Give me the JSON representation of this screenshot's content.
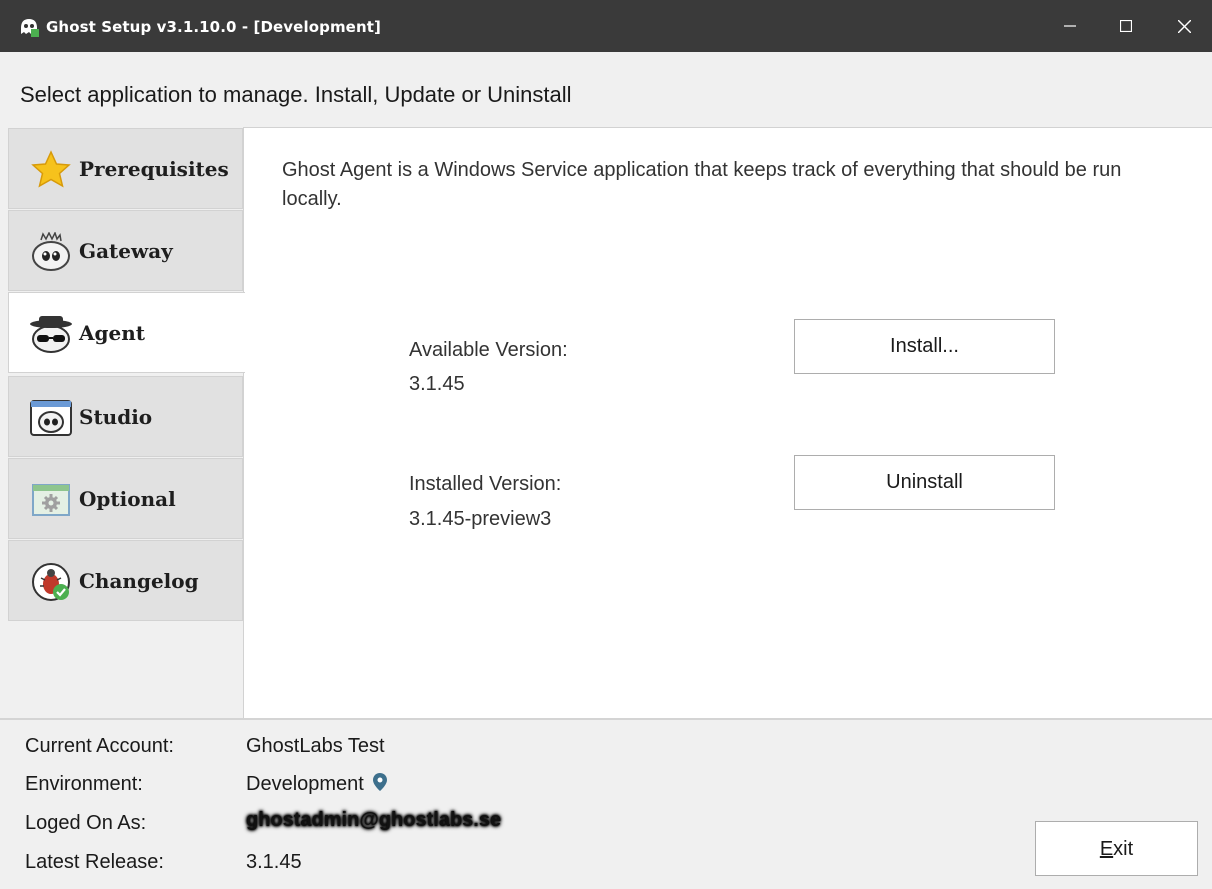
{
  "window": {
    "title": "Ghost Setup v3.1.10.0  -  [Development]",
    "min_icon": "minimize-icon",
    "max_icon": "maximize-icon",
    "close_icon": "close-icon"
  },
  "header": {
    "text": "Select application to manage. Install, Update or Uninstall"
  },
  "tabs": [
    {
      "label": "Prerequisites",
      "icon": "star-icon",
      "active": false
    },
    {
      "label": "Gateway",
      "icon": "ghost-gateway-icon",
      "active": false
    },
    {
      "label": "Agent",
      "icon": "ghost-agent-icon",
      "active": true
    },
    {
      "label": "Studio",
      "icon": "ghost-studio-icon",
      "active": false
    },
    {
      "label": "Optional",
      "icon": "gear-window-icon",
      "active": false
    },
    {
      "label": "Changelog",
      "icon": "bug-check-icon",
      "active": false
    }
  ],
  "panel": {
    "description": "Ghost Agent is a Windows Service application that keeps track of everything that should be run locally.",
    "available_label": "Available Version:",
    "available_value": "3.1.45",
    "installed_label": "Installed Version:",
    "installed_value": "3.1.45-preview3",
    "install_button": "Install...",
    "uninstall_button": "Uninstall"
  },
  "footer": {
    "account_label": "Current Account:",
    "account_value": "GhostLabs Test",
    "env_label": "Environment:",
    "env_value": "Development",
    "env_icon": "location-pin-icon",
    "logon_label": "Loged On As:",
    "logon_value": "ghostadmin@ghostlabs.se",
    "release_label": "Latest Release:",
    "release_value": "3.1.45",
    "exit_button": "Exit"
  },
  "colors": {
    "titlebar": "#3a3a3a",
    "pin": "#3d6f8c",
    "star": "#f6c21c"
  }
}
